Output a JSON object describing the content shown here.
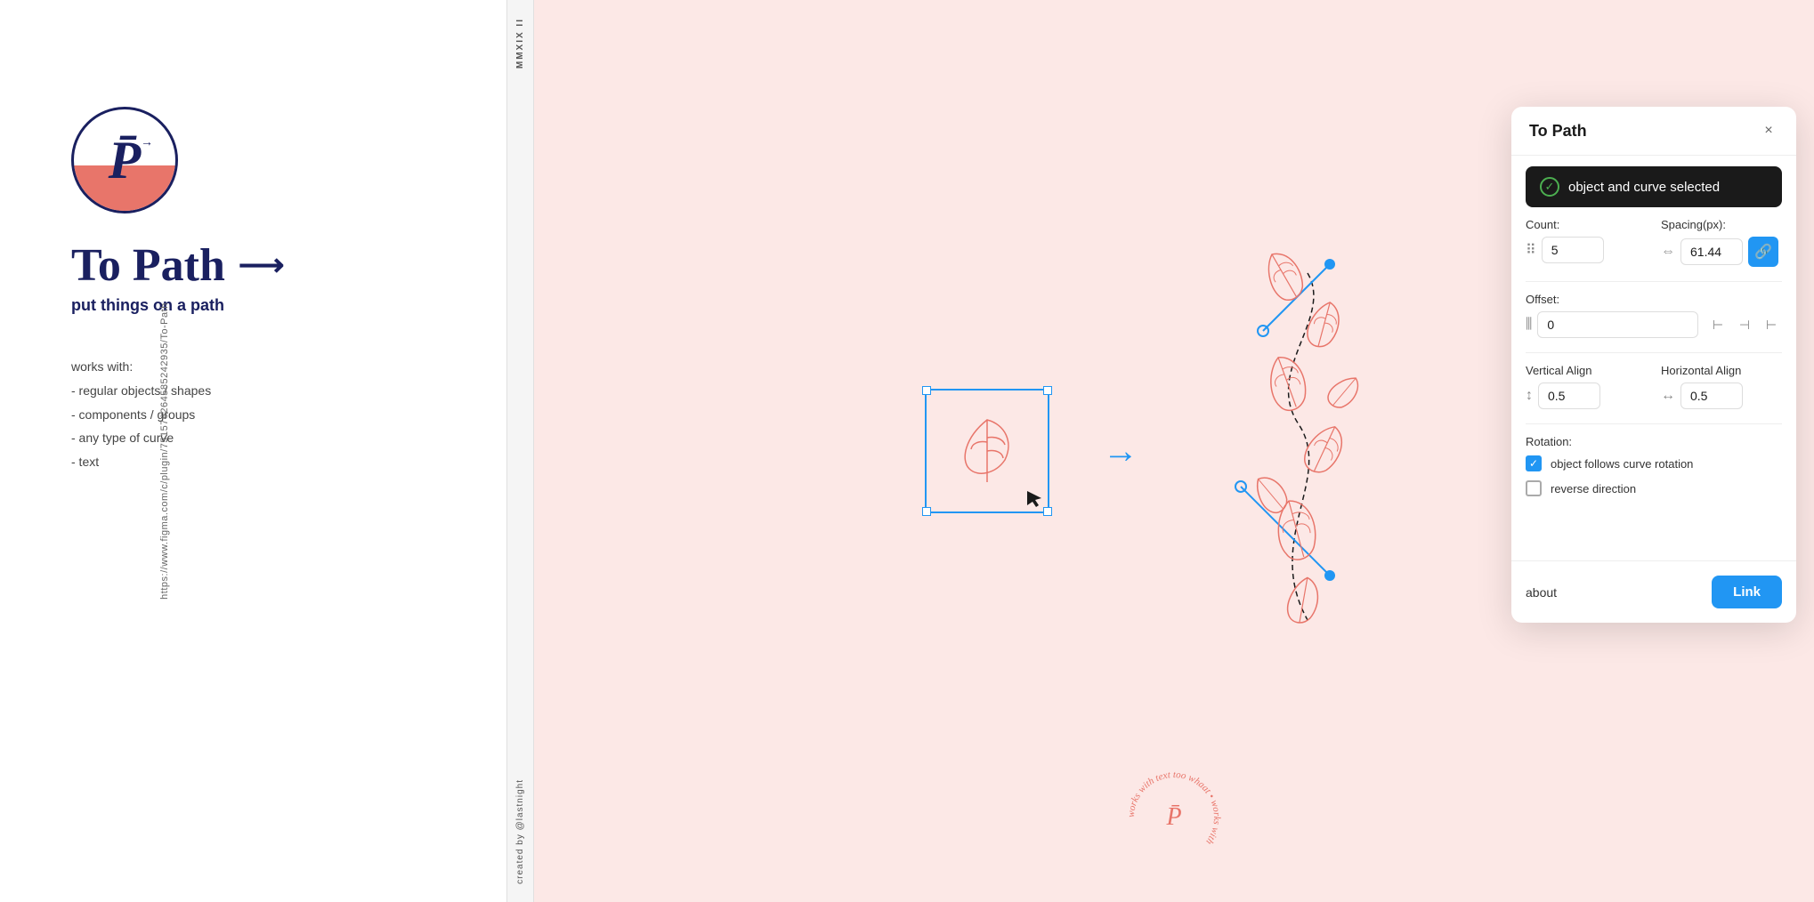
{
  "sidebar": {
    "url": "https://www.figma.com/c/plugin/751576264585242935/To-Path"
  },
  "left_panel": {
    "logo_letter": "P",
    "main_title": "To Path",
    "subtitle": "put things on a path",
    "works_with_label": "works with:",
    "works_with_items": [
      "- regular objects / shapes",
      "- components / groups",
      "- any type of curve",
      "- text"
    ]
  },
  "divider": {
    "top_text": "MMXIX II",
    "bottom_text": "created by @lastnight"
  },
  "plugin": {
    "title": "To Path",
    "close_label": "×",
    "status_text": "object and curve selected",
    "count_label": "Count:",
    "count_value": "5",
    "spacing_label": "Spacing(px):",
    "spacing_value": "61.44",
    "offset_label": "Offset:",
    "offset_value": "0",
    "vertical_align_label": "Vertical Align",
    "vertical_align_value": "0.5",
    "horizontal_align_label": "Horizontal Align",
    "horizontal_align_value": "0.5",
    "rotation_label": "Rotation:",
    "object_follows_label": "object follows curve rotation",
    "reverse_direction_label": "reverse direction",
    "about_label": "about",
    "link_button_label": "Link"
  },
  "bottom_watermark": {
    "text": "works with text too whaat"
  }
}
